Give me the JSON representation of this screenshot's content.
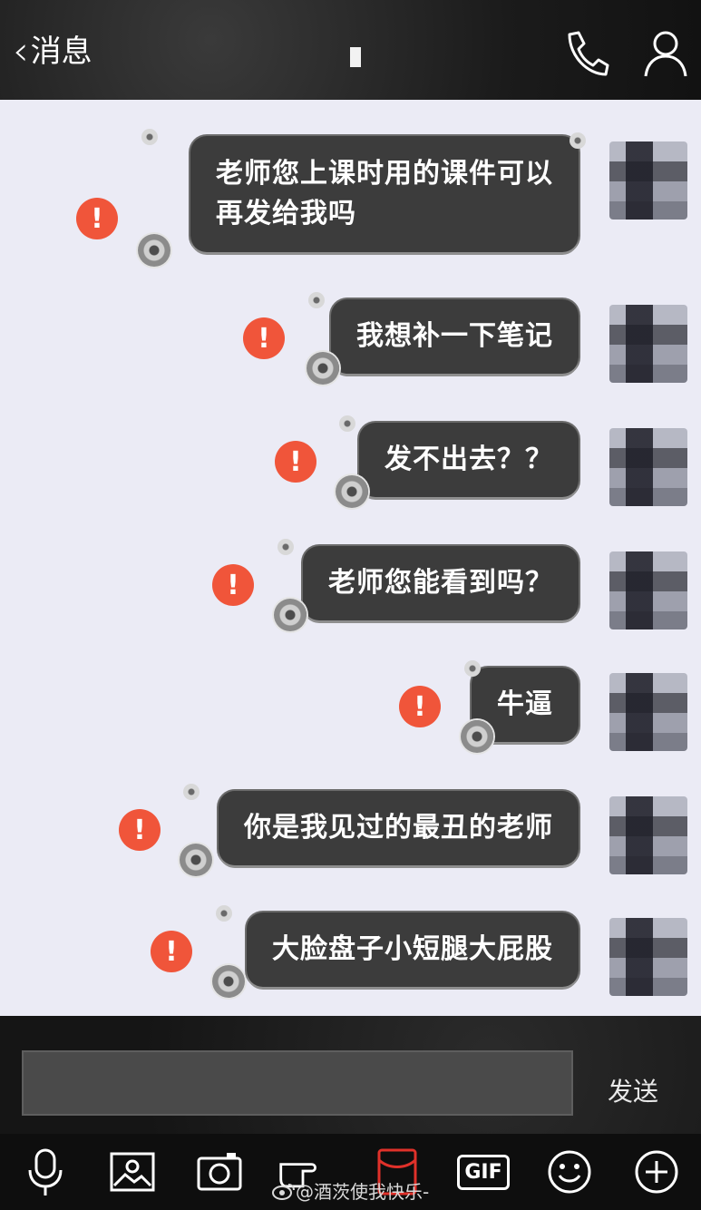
{
  "header": {
    "back_label": "消息"
  },
  "messages": [
    {
      "text_lines": [
        "老师您上课时用的课件可以",
        "再发给我吗"
      ],
      "status": "failed"
    },
    {
      "text": "我想补一下笔记",
      "status": "failed"
    },
    {
      "text": "发不出去？？",
      "status": "failed"
    },
    {
      "text": "老师您能看到吗？",
      "status": "failed"
    },
    {
      "text": "牛逼",
      "status": "failed"
    },
    {
      "text": "你是我见过的最丑的老师",
      "status": "failed"
    },
    {
      "text": "大脸盘子小短腿大屁股",
      "status": "failed"
    }
  ],
  "composer": {
    "send_label": "发送"
  },
  "toolbar": {
    "tools": [
      "microphone-icon",
      "image-icon",
      "camera-icon",
      "poke-icon",
      "red-packet-icon",
      "gif-icon",
      "emoji-icon",
      "plus-icon"
    ],
    "gif_label": "GIF"
  },
  "watermark": {
    "text": "@酒茨使我快乐-"
  },
  "colors": {
    "error": "#f0553a",
    "bubble": "#3c3c3c",
    "chat_bg": "#ebebf5"
  }
}
